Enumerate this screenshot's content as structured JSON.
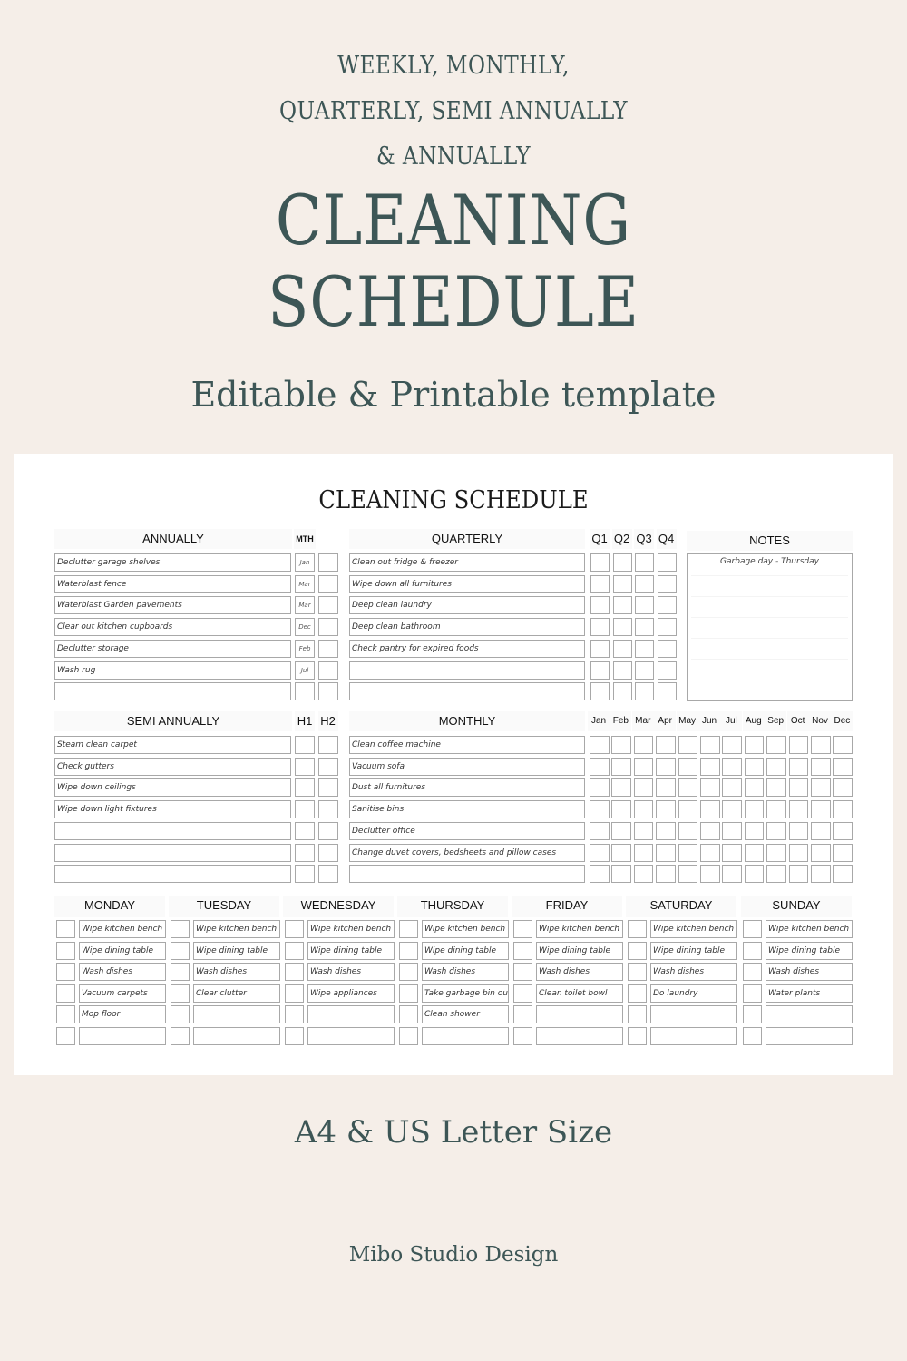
{
  "hero": {
    "subtitle_lines": [
      "WEEKLY, MONTHLY,",
      "QUARTERLY, SEMI ANNUALLY",
      "& ANNUALLY"
    ],
    "title_lines": [
      "CLEANING",
      "SCHEDULE"
    ],
    "tagline": "Editable & Printable template",
    "size_info": "A4 & US Letter Size",
    "brand": "Mibo Studio Design"
  },
  "colors": {
    "background": "#f5eee8",
    "accent_text": "#3d5656",
    "card": "#ffffff",
    "box_border": "#a8a8a8"
  },
  "sheet": {
    "title": "CLEANING SCHEDULE",
    "annually": {
      "heading": "ANNUALLY",
      "month_heading": "MTH",
      "rows": [
        {
          "task": "Declutter garage shelves",
          "month": "Jan"
        },
        {
          "task": "Waterblast fence",
          "month": "Mar"
        },
        {
          "task": "Waterblast Garden pavements",
          "month": "Mar"
        },
        {
          "task": "Clear out kitchen cupboards",
          "month": "Dec"
        },
        {
          "task": "Declutter storage",
          "month": "Feb"
        },
        {
          "task": "Wash rug",
          "month": "Jul"
        },
        {
          "task": "",
          "month": ""
        }
      ]
    },
    "quarterly": {
      "heading": "QUARTERLY",
      "columns": [
        "Q1",
        "Q2",
        "Q3",
        "Q4"
      ],
      "rows": [
        "Clean out fridge & freezer",
        "Wipe down all furnitures",
        "Deep clean laundry",
        "Deep clean bathroom",
        "Check pantry for expired foods",
        "",
        ""
      ]
    },
    "notes": {
      "heading": "NOTES",
      "text": "Garbage day - Thursday"
    },
    "semi_annually": {
      "heading": "SEMI ANNUALLY",
      "columns": [
        "H1",
        "H2"
      ],
      "rows": [
        "Steam clean carpet",
        "Check gutters",
        "Wipe down ceilings",
        "Wipe down light fixtures",
        "",
        "",
        ""
      ]
    },
    "monthly": {
      "heading": "MONTHLY",
      "columns": [
        "Jan",
        "Feb",
        "Mar",
        "Apr",
        "May",
        "Jun",
        "Jul",
        "Aug",
        "Sep",
        "Oct",
        "Nov",
        "Dec"
      ],
      "rows": [
        "Clean coffee machine",
        "Vacuum sofa",
        "Dust all furnitures",
        "Sanitise bins",
        "Declutter office",
        "Change duvet covers, bedsheets and pillow cases",
        ""
      ]
    },
    "weekly": {
      "days": [
        {
          "name": "MONDAY",
          "tasks": [
            "Wipe kitchen bench",
            "Wipe dining table",
            "Wash dishes",
            "Vacuum carpets",
            "Mop floor",
            ""
          ]
        },
        {
          "name": "TUESDAY",
          "tasks": [
            "Wipe kitchen bench",
            "Wipe dining table",
            "Wash dishes",
            "Clear clutter",
            "",
            ""
          ]
        },
        {
          "name": "WEDNESDAY",
          "tasks": [
            "Wipe kitchen bench",
            "Wipe dining table",
            "Wash dishes",
            "Wipe appliances",
            "",
            ""
          ]
        },
        {
          "name": "THURSDAY",
          "tasks": [
            "Wipe kitchen bench",
            "Wipe dining table",
            "Wash dishes",
            "Take garbage bin out",
            "Clean shower",
            ""
          ]
        },
        {
          "name": "FRIDAY",
          "tasks": [
            "Wipe kitchen bench",
            "Wipe dining table",
            "Wash dishes",
            "Clean toilet bowl",
            "",
            ""
          ]
        },
        {
          "name": "SATURDAY",
          "tasks": [
            "Wipe kitchen bench",
            "Wipe dining table",
            "Wash dishes",
            "Do laundry",
            "",
            ""
          ]
        },
        {
          "name": "SUNDAY",
          "tasks": [
            "Wipe kitchen bench",
            "Wipe dining table",
            "Wash dishes",
            "Water plants",
            "",
            ""
          ]
        }
      ]
    }
  }
}
